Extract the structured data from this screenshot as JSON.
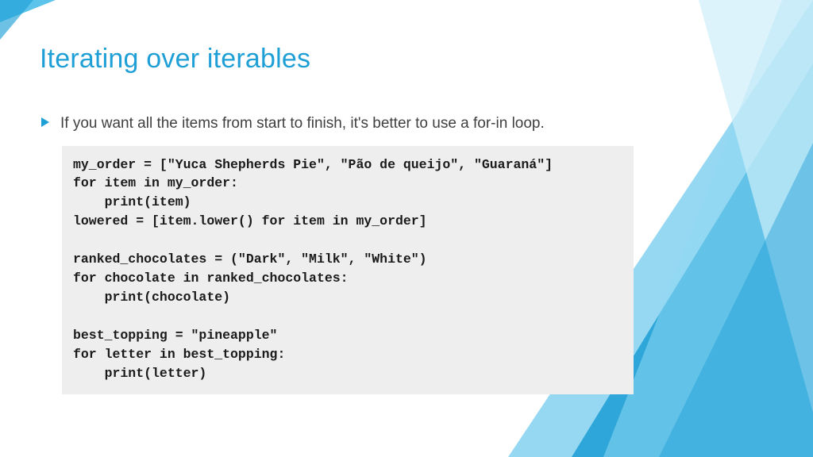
{
  "title": "Iterating over iterables",
  "bullet": "If you want all the items from start to finish, it's better to use a for-in loop.",
  "code": "my_order = [\"Yuca Shepherds Pie\", \"Pão de queijo\", \"Guaraná\"]\nfor item in my_order:\n    print(item)\nlowered = [item.lower() for item in my_order]\n\nranked_chocolates = (\"Dark\", \"Milk\", \"White\")\nfor chocolate in ranked_chocolates:\n    print(chocolate)\n\nbest_topping = \"pineapple\"\nfor letter in best_topping:\n    print(letter)",
  "theme": {
    "accent": "#1e9fd6",
    "code_bg": "#eeeeee"
  }
}
